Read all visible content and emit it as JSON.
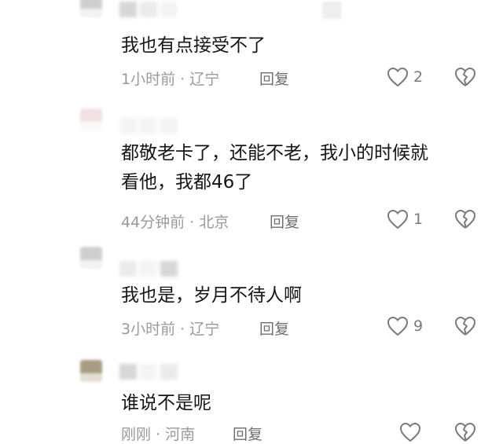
{
  "comments": [
    {
      "text": "我也有点接受不了",
      "time": "1小时前",
      "sep": "·",
      "location": "辽宁",
      "reply_label": "回复",
      "likes": "2"
    },
    {
      "text": "都敬老卡了，还能不老，我小的时候就\n看他，我都46了",
      "time": "44分钟前",
      "sep": "·",
      "location": "北京",
      "reply_label": "回复",
      "likes": "1"
    },
    {
      "text": "我也是，岁月不待人啊",
      "time": "3小时前",
      "sep": "·",
      "location": "辽宁",
      "reply_label": "回复",
      "likes": "9"
    },
    {
      "text": "谁说不是呢",
      "time": "刚刚",
      "sep": "·",
      "location": "河南",
      "reply_label": "回复",
      "likes": ""
    }
  ],
  "icons": {
    "like": "heart-outline-icon",
    "dislike": "broken-heart-icon"
  },
  "colors": {
    "text": "#151515",
    "meta": "#9a9a9a",
    "icon": "#7a7a7a"
  }
}
